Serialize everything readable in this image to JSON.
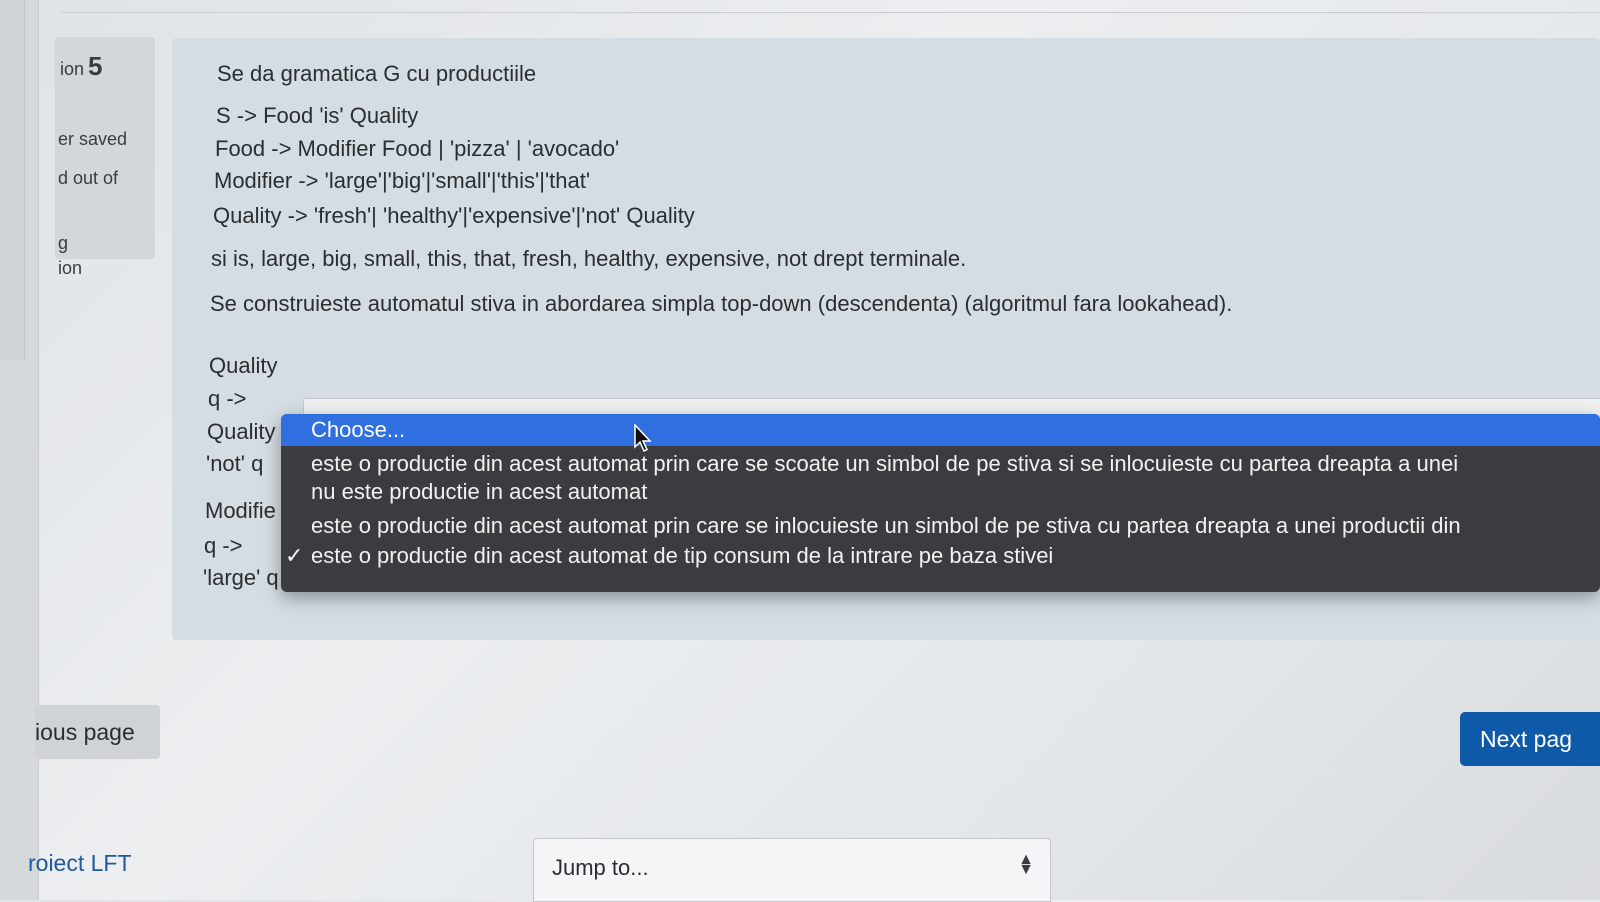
{
  "sidebar": {
    "question_prefix": "ion",
    "question_number": "5",
    "saved_text": "er saved",
    "marked_text": "d out of",
    "flag_text": "g",
    "edit_text": "ion"
  },
  "question": {
    "intro": "Se da gramatica G cu productiile",
    "productions": [
      "S -> Food 'is' Quality",
      "Food -> Modifier Food | 'pizza' | 'avocado'",
      "Modifier -> 'large'|'big'|'small'|'this'|'that'",
      "Quality -> 'fresh'| 'healthy'|'expensive'|'not' Quality"
    ],
    "terminals": "si is, large, big, small, this, that, fresh, healthy, expensive, not drept terminale.",
    "construction": "Se construieste automatul stiva in abordarea simpla top-down (descendenta) (algoritmul fara lookahead).",
    "items": [
      {
        "line1": "Quality",
        "line2": "q ->",
        "line3": "Quality"
      },
      {
        "line1": "'not' q"
      },
      {
        "line1": "Modifie",
        "line2": "q ->",
        "line3": "'large' q"
      }
    ]
  },
  "dropdown": {
    "options": [
      {
        "label": "Choose...",
        "highlighted": true,
        "checked": false
      },
      {
        "label": "este o productie din acest automat prin care se scoate un simbol de pe stiva si se inlocuieste cu partea dreapta a unei",
        "highlighted": false,
        "checked": false
      },
      {
        "label": "nu este productie in acest automat",
        "highlighted": false,
        "checked": false
      },
      {
        "label": "este o productie din acest automat prin care se inlocuieste un simbol de pe stiva cu partea dreapta a unei productii din",
        "highlighted": false,
        "checked": false
      },
      {
        "label": "este o productie din acest automat de tip consum de la intrare pe baza stivei",
        "highlighted": false,
        "checked": true
      }
    ],
    "check_glyph": "✓",
    "highlight_color": "#2f6fe0"
  },
  "navigation": {
    "previous_label": "ious page",
    "next_label": "Next pag",
    "next_color": "#0f5aa8"
  },
  "footer": {
    "course_link": "roiect LFT",
    "jump_placeholder": "Jump to..."
  }
}
